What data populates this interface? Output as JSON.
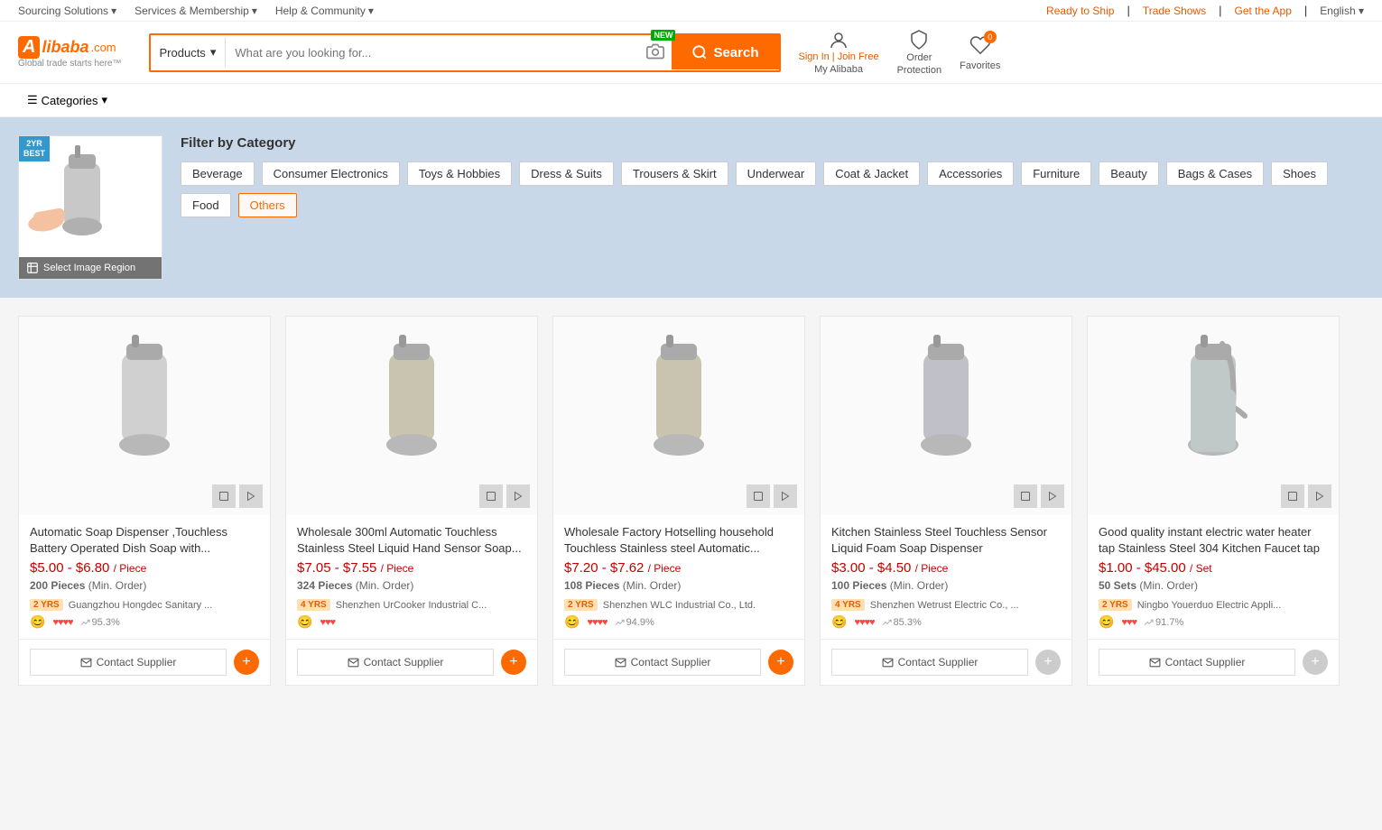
{
  "topNav": {
    "left": [
      {
        "label": "Sourcing Solutions",
        "arrow": true
      },
      {
        "label": "Services & Membership",
        "arrow": true
      },
      {
        "label": "Help & Community",
        "arrow": true
      }
    ],
    "right": [
      {
        "label": "Ready to Ship",
        "highlight": true
      },
      {
        "label": "Trade Shows",
        "highlight": true
      },
      {
        "label": "Get the App",
        "highlight": true
      },
      {
        "label": "English",
        "arrow": true
      }
    ]
  },
  "logo": {
    "brand": "Alibaba.com",
    "tagline": "Global trade starts here™"
  },
  "search": {
    "dropdown": "Products",
    "placeholder": "What are you looking for...",
    "button": "Search",
    "new_badge": "NEW"
  },
  "nav_links": [
    {
      "label": "Sourcing Solutions",
      "arrow": true
    },
    {
      "label": "Services & Membership",
      "arrow": true
    },
    {
      "label": "Help & Community",
      "arrow": true
    }
  ],
  "account": {
    "sign_in": "Sign In",
    "join": "Join Free",
    "my_alibaba": "My Alibaba"
  },
  "order_protection": {
    "label": "Order",
    "label2": "Protection"
  },
  "favorites": {
    "label": "Favorites",
    "count": "0"
  },
  "categories_btn": "Categories",
  "imageSearch": {
    "badge": "2YR\nBEST",
    "overlay_label": "Select Image Region"
  },
  "filter": {
    "title": "Filter by Category",
    "tags": [
      {
        "label": "Beverage",
        "active": false
      },
      {
        "label": "Consumer Electronics",
        "active": false
      },
      {
        "label": "Toys & Hobbies",
        "active": false
      },
      {
        "label": "Dress & Suits",
        "active": false
      },
      {
        "label": "Trousers & Skirt",
        "active": false
      },
      {
        "label": "Underwear",
        "active": false
      },
      {
        "label": "Coat & Jacket",
        "active": false
      },
      {
        "label": "Accessories",
        "active": false
      },
      {
        "label": "Furniture",
        "active": false
      },
      {
        "label": "Beauty",
        "active": false
      },
      {
        "label": "Bags & Cases",
        "active": false
      },
      {
        "label": "Shoes",
        "active": false
      },
      {
        "label": "Food",
        "active": false
      },
      {
        "label": "Others",
        "active": true
      }
    ]
  },
  "products": [
    {
      "title": "Automatic Soap Dispenser ,Touchless Battery Operated Dish Soap with...",
      "price_range": "$5.00 - $6.80",
      "unit": "/ Piece",
      "moq": "200 Pieces",
      "moq_label": "(Min. Order)",
      "yrs": "2",
      "supplier": "Guangzhou Hongdec Sanitary ...",
      "rating_pct": "95.3%"
    },
    {
      "title": "Wholesale 300ml Automatic Touchless Stainless Steel Liquid Hand Sensor Soap...",
      "price_range": "$7.05 - $7.55",
      "unit": "/ Piece",
      "moq": "324 Pieces",
      "moq_label": "(Min. Order)",
      "yrs": "4",
      "supplier": "Shenzhen UrCooker Industrial C...",
      "rating_pct": ""
    },
    {
      "title": "Wholesale Factory Hotselling household Touchless Stainless steel Automatic...",
      "price_range": "$7.20 - $7.62",
      "unit": "/ Piece",
      "moq": "108 Pieces",
      "moq_label": "(Min. Order)",
      "yrs": "2",
      "supplier": "Shenzhen WLC Industrial Co., Ltd.",
      "rating_pct": "94.9%"
    },
    {
      "title": "Kitchen Stainless Steel Touchless Sensor Liquid Foam Soap Dispenser",
      "price_range": "$3.00 - $4.50",
      "unit": "/ Piece",
      "moq": "100 Pieces",
      "moq_label": "(Min. Order)",
      "yrs": "4",
      "supplier": "Shenzhen Wetrust Electric Co., ...",
      "rating_pct": "85.3%"
    },
    {
      "title": "Good quality instant electric water heater tap Stainless Steel 304 Kitchen Faucet tap",
      "price_range": "$1.00 - $45.00",
      "unit": "/ Set",
      "moq": "50 Sets",
      "moq_label": "(Min. Order)",
      "yrs": "2",
      "supplier": "Ningbo Youerduo Electric Appli...",
      "rating_pct": "91.7%"
    }
  ],
  "contact_btn": "Contact Supplier"
}
